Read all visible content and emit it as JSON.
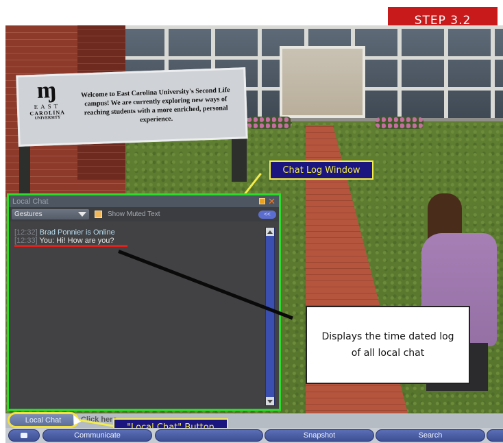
{
  "step_badge": "STEP 3.2",
  "sign": {
    "logo_east": "EAST",
    "logo_carolina": "CAROLINA",
    "logo_university": "UNIVERSITY",
    "text": "Welcome to East Carolina University's Second Life campus! We are currently exploring new ways of reaching students with a more enriched, personal experience."
  },
  "callouts": {
    "chat_log_window": "Chat Log Window",
    "local_chat_button": "\"Local Chat\" Button"
  },
  "chat_window": {
    "title": "Local Chat",
    "gestures_label": "Gestures",
    "show_muted_label": "Show Muted Text",
    "toggle_label": "<<",
    "lines": [
      {
        "time": "[12:32]",
        "msg": "Brad Ponnier is Online"
      },
      {
        "time": "[12:33]",
        "msg": "You: Hi! How are you?"
      }
    ]
  },
  "info_box": "Displays the time dated log of all local chat",
  "bottom": {
    "local_chat_button": "Local Chat",
    "click_here": "Click here",
    "toolbar": {
      "communicate": "Communicate",
      "snapshot": "Snapshot",
      "search": "Search"
    }
  },
  "colors": {
    "step_badge": "#c8191b",
    "window_highlight": "#2ddc2a",
    "callout_bg": "#1b1580",
    "callout_text": "#f4ec4a",
    "underline": "#e0201d"
  }
}
